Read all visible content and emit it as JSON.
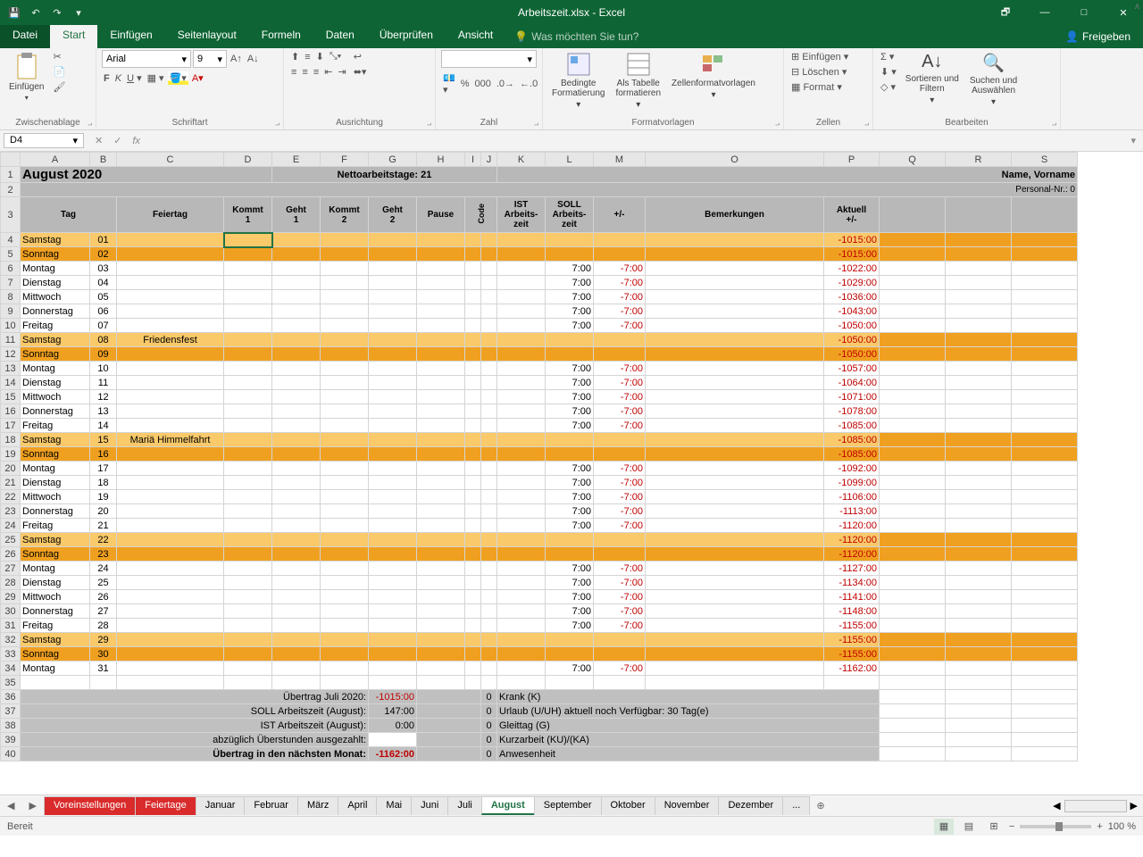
{
  "app": {
    "title": "Arbeitszeit.xlsx - Excel"
  },
  "qat": {
    "save": "💾",
    "undo": "↶",
    "redo": "↷"
  },
  "win": {
    "restore": "🗗",
    "min": "—",
    "max": "□",
    "close": "✕"
  },
  "tabs": {
    "file": "Datei",
    "home": "Start",
    "insert": "Einfügen",
    "layout": "Seitenlayout",
    "formulas": "Formeln",
    "data": "Daten",
    "review": "Überprüfen",
    "view": "Ansicht",
    "tellme": "Was möchten Sie tun?",
    "share": "Freigeben"
  },
  "ribbon": {
    "clipboard": {
      "label": "Zwischenablage",
      "paste": "Einfügen"
    },
    "font": {
      "label": "Schriftart",
      "name": "Arial",
      "size": "9"
    },
    "align": {
      "label": "Ausrichtung"
    },
    "number": {
      "label": "Zahl"
    },
    "styles": {
      "label": "Formatvorlagen",
      "cond": "Bedingte\nFormatierung",
      "table": "Als Tabelle\nformatieren",
      "cell": "Zellenformatvorlagen"
    },
    "cells": {
      "label": "Zellen",
      "insert": "Einfügen",
      "delete": "Löschen",
      "format": "Format"
    },
    "edit": {
      "label": "Bearbeiten",
      "sort": "Sortieren und\nFiltern",
      "find": "Suchen und\nAuswählen"
    }
  },
  "namebox": "D4",
  "cols": [
    "A",
    "B",
    "C",
    "D",
    "E",
    "F",
    "G",
    "H",
    "I",
    "J",
    "K",
    "L",
    "M",
    "O",
    "P",
    "Q",
    "R",
    "S"
  ],
  "month": "August 2020",
  "netto": "Nettoarbeitstage: 21",
  "nameLabel": "Name, Vorname",
  "personal": "Personal-Nr.: 0",
  "headers": {
    "tag": "Tag",
    "feiertag": "Feiertag",
    "k1": "Kommt\n1",
    "g1": "Geht\n1",
    "k2": "Kommt\n2",
    "g2": "Geht\n2",
    "pause": "Pause",
    "code": "Code",
    "ist": "IST\nArbeits-\nzeit",
    "soll": "SOLL\nArbeits-\nzeit",
    "pm": "+/-",
    "bem": "Bemerkungen",
    "akt": "Aktuell\n+/-"
  },
  "rows": [
    {
      "n": 4,
      "day": "Samstag",
      "num": "01",
      "we": "s",
      "akt": "-1015:00"
    },
    {
      "n": 5,
      "day": "Sonntag",
      "num": "02",
      "we": "o",
      "akt": "-1015:00"
    },
    {
      "n": 6,
      "day": "Montag",
      "num": "03",
      "soll": "7:00",
      "pm": "-7:00",
      "akt": "-1022:00"
    },
    {
      "n": 7,
      "day": "Dienstag",
      "num": "04",
      "soll": "7:00",
      "pm": "-7:00",
      "akt": "-1029:00"
    },
    {
      "n": 8,
      "day": "Mittwoch",
      "num": "05",
      "soll": "7:00",
      "pm": "-7:00",
      "akt": "-1036:00"
    },
    {
      "n": 9,
      "day": "Donnerstag",
      "num": "06",
      "soll": "7:00",
      "pm": "-7:00",
      "akt": "-1043:00"
    },
    {
      "n": 10,
      "day": "Freitag",
      "num": "07",
      "soll": "7:00",
      "pm": "-7:00",
      "akt": "-1050:00"
    },
    {
      "n": 11,
      "day": "Samstag",
      "num": "08",
      "we": "s",
      "feier": "Friedensfest",
      "akt": "-1050:00"
    },
    {
      "n": 12,
      "day": "Sonntag",
      "num": "09",
      "we": "o",
      "akt": "-1050:00"
    },
    {
      "n": 13,
      "day": "Montag",
      "num": "10",
      "soll": "7:00",
      "pm": "-7:00",
      "akt": "-1057:00"
    },
    {
      "n": 14,
      "day": "Dienstag",
      "num": "11",
      "soll": "7:00",
      "pm": "-7:00",
      "akt": "-1064:00"
    },
    {
      "n": 15,
      "day": "Mittwoch",
      "num": "12",
      "soll": "7:00",
      "pm": "-7:00",
      "akt": "-1071:00"
    },
    {
      "n": 16,
      "day": "Donnerstag",
      "num": "13",
      "soll": "7:00",
      "pm": "-7:00",
      "akt": "-1078:00"
    },
    {
      "n": 17,
      "day": "Freitag",
      "num": "14",
      "soll": "7:00",
      "pm": "-7:00",
      "akt": "-1085:00"
    },
    {
      "n": 18,
      "day": "Samstag",
      "num": "15",
      "we": "s",
      "feier": "Mariä Himmelfahrt",
      "akt": "-1085:00"
    },
    {
      "n": 19,
      "day": "Sonntag",
      "num": "16",
      "we": "o",
      "akt": "-1085:00"
    },
    {
      "n": 20,
      "day": "Montag",
      "num": "17",
      "soll": "7:00",
      "pm": "-7:00",
      "akt": "-1092:00"
    },
    {
      "n": 21,
      "day": "Dienstag",
      "num": "18",
      "soll": "7:00",
      "pm": "-7:00",
      "akt": "-1099:00"
    },
    {
      "n": 22,
      "day": "Mittwoch",
      "num": "19",
      "soll": "7:00",
      "pm": "-7:00",
      "akt": "-1106:00"
    },
    {
      "n": 23,
      "day": "Donnerstag",
      "num": "20",
      "soll": "7:00",
      "pm": "-7:00",
      "akt": "-1113:00"
    },
    {
      "n": 24,
      "day": "Freitag",
      "num": "21",
      "soll": "7:00",
      "pm": "-7:00",
      "akt": "-1120:00"
    },
    {
      "n": 25,
      "day": "Samstag",
      "num": "22",
      "we": "s",
      "akt": "-1120:00"
    },
    {
      "n": 26,
      "day": "Sonntag",
      "num": "23",
      "we": "o",
      "akt": "-1120:00"
    },
    {
      "n": 27,
      "day": "Montag",
      "num": "24",
      "soll": "7:00",
      "pm": "-7:00",
      "akt": "-1127:00"
    },
    {
      "n": 28,
      "day": "Dienstag",
      "num": "25",
      "soll": "7:00",
      "pm": "-7:00",
      "akt": "-1134:00"
    },
    {
      "n": 29,
      "day": "Mittwoch",
      "num": "26",
      "soll": "7:00",
      "pm": "-7:00",
      "akt": "-1141:00"
    },
    {
      "n": 30,
      "day": "Donnerstag",
      "num": "27",
      "soll": "7:00",
      "pm": "-7:00",
      "akt": "-1148:00"
    },
    {
      "n": 31,
      "day": "Freitag",
      "num": "28",
      "soll": "7:00",
      "pm": "-7:00",
      "akt": "-1155:00"
    },
    {
      "n": 32,
      "day": "Samstag",
      "num": "29",
      "we": "s",
      "akt": "-1155:00"
    },
    {
      "n": 33,
      "day": "Sonntag",
      "num": "30",
      "we": "o",
      "akt": "-1155:00"
    },
    {
      "n": 34,
      "day": "Montag",
      "num": "31",
      "soll": "7:00",
      "pm": "-7:00",
      "akt": "-1162:00"
    }
  ],
  "summary": [
    {
      "n": 36,
      "label": "Übertrag Juli 2020:",
      "val": "-1015:00",
      "neg": true
    },
    {
      "n": 37,
      "label": "SOLL Arbeitszeit (August):",
      "val": "147:00"
    },
    {
      "n": 38,
      "label": "IST Arbeitszeit (August):",
      "val": "0:00"
    },
    {
      "n": 39,
      "label": "abzüglich Überstunden ausgezahlt:",
      "val": "",
      "white": true
    },
    {
      "n": 40,
      "label": "Übertrag in den nächsten Monat:",
      "val": "-1162:00",
      "neg": true,
      "bold": true
    }
  ],
  "legend": [
    {
      "v": "0",
      "t": "Krank (K)"
    },
    {
      "v": "0",
      "t": "Urlaub (U/UH) aktuell noch Verfügbar: 30 Tag(e)"
    },
    {
      "v": "0",
      "t": "Gleittag (G)"
    },
    {
      "v": "0",
      "t": "Kurzarbeit (KU)/(KA)"
    },
    {
      "v": "0",
      "t": "Anwesenheit"
    }
  ],
  "sheets": [
    {
      "name": "Voreinstellungen",
      "cls": "red"
    },
    {
      "name": "Feiertage",
      "cls": "red"
    },
    {
      "name": "Januar"
    },
    {
      "name": "Februar"
    },
    {
      "name": "März"
    },
    {
      "name": "April"
    },
    {
      "name": "Mai"
    },
    {
      "name": "Juni"
    },
    {
      "name": "Juli"
    },
    {
      "name": "August",
      "cls": "active"
    },
    {
      "name": "September"
    },
    {
      "name": "Oktober"
    },
    {
      "name": "November"
    },
    {
      "name": "Dezember"
    },
    {
      "name": "..."
    }
  ],
  "status": {
    "ready": "Bereit",
    "zoom": "100 %"
  }
}
